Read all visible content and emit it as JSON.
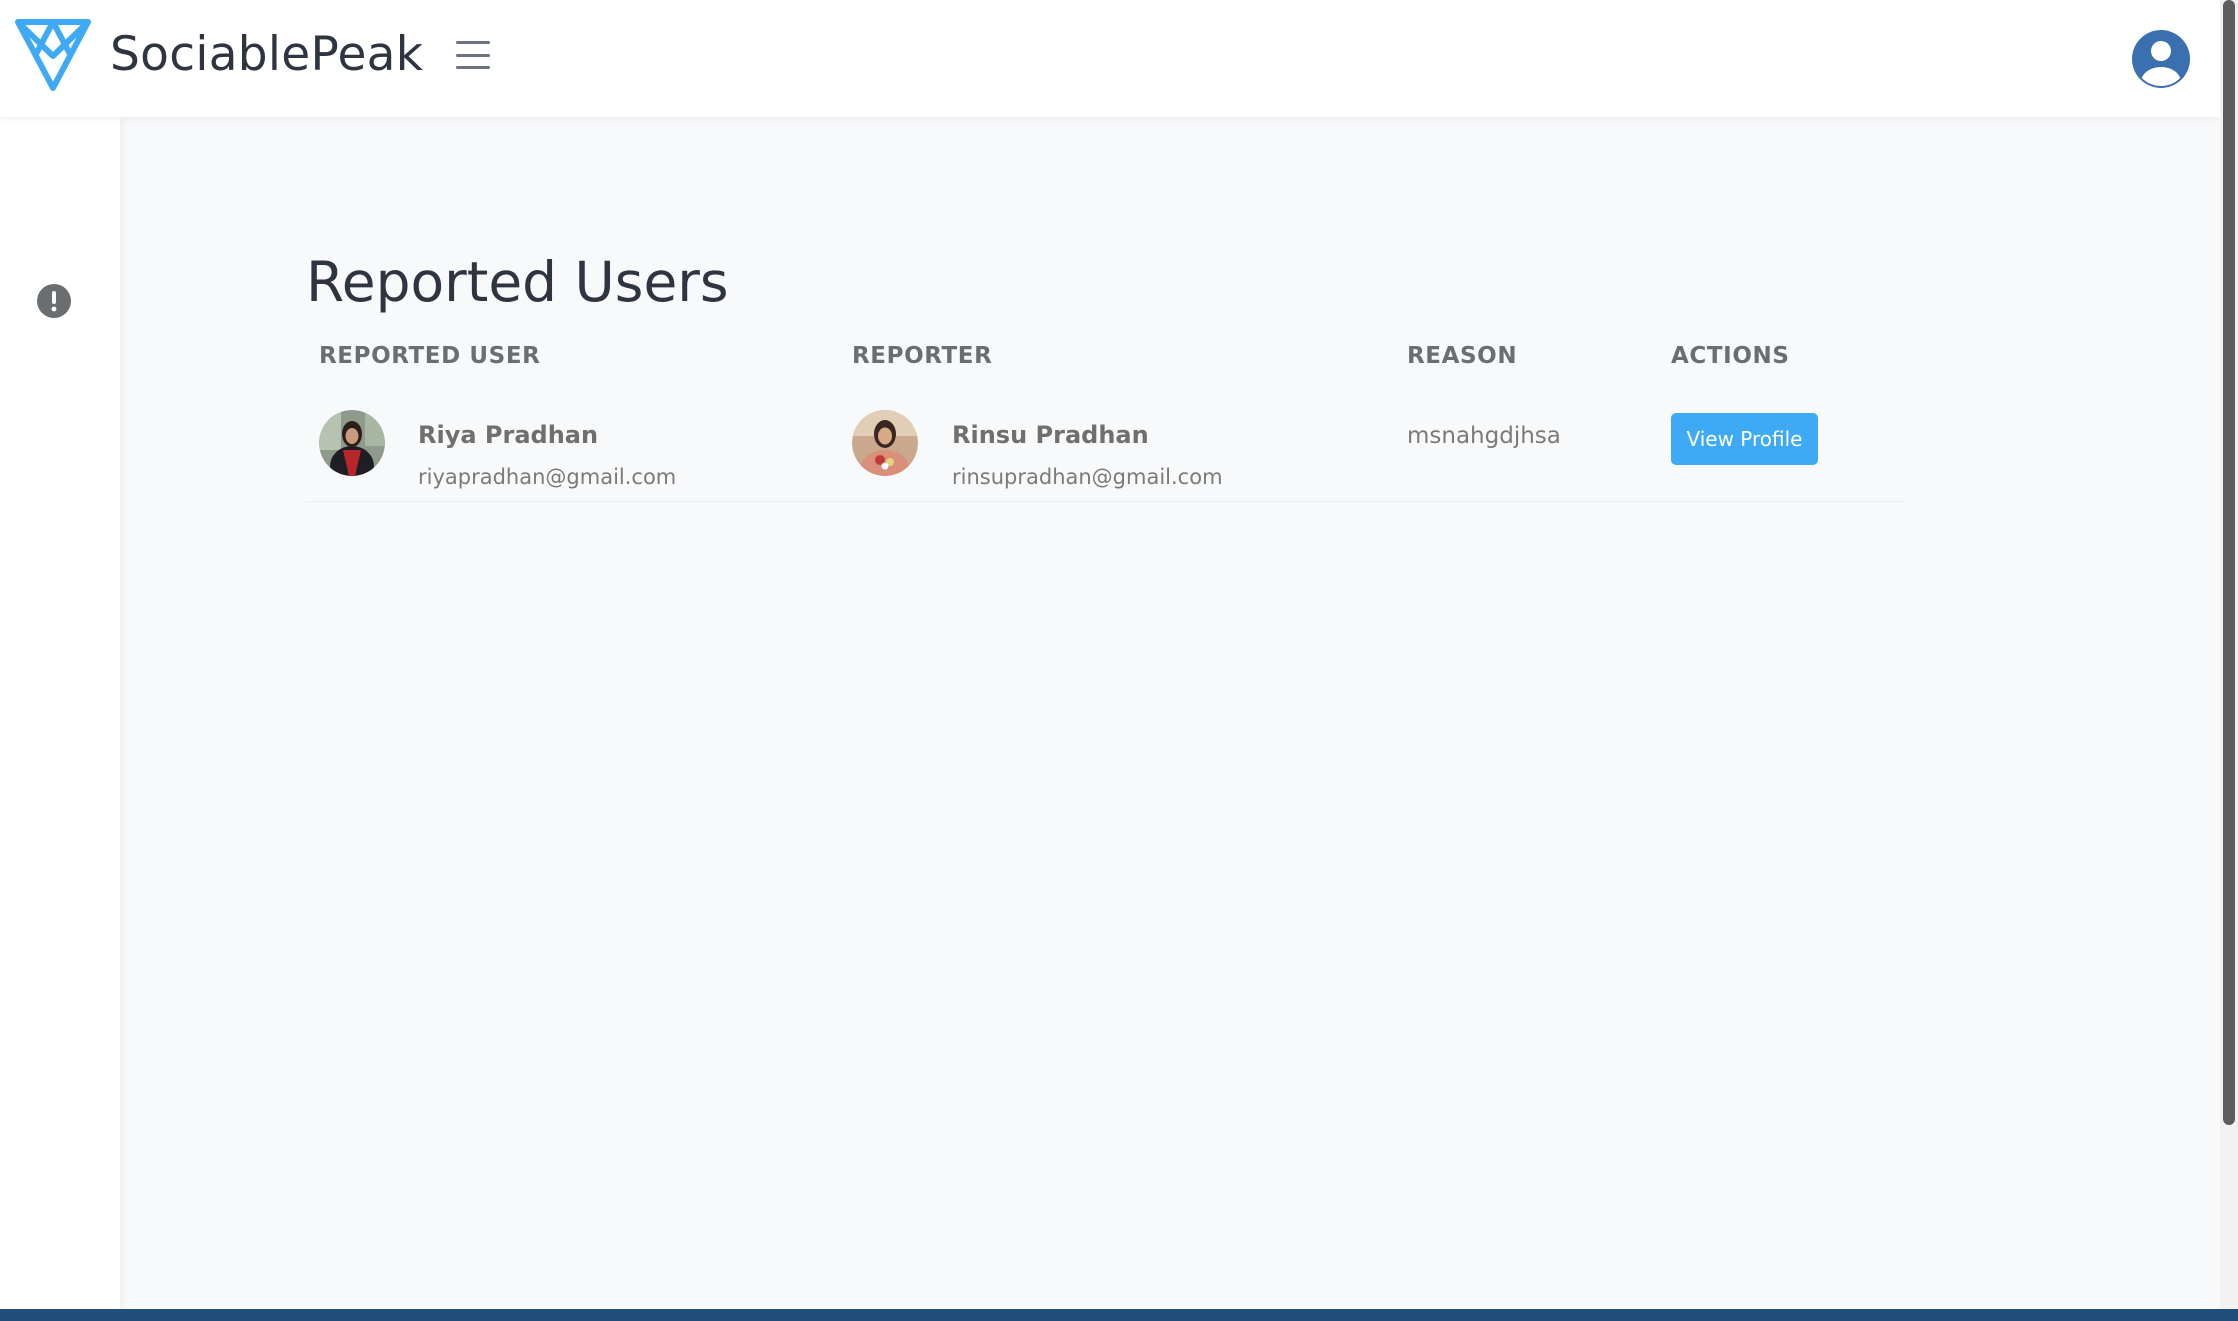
{
  "header": {
    "app_title": "SociablePeak",
    "brand_color": "#3eaaf5",
    "menu_icon": "hamburger-menu-icon",
    "user_icon": "user-circle-icon",
    "user_icon_color": "#3a6fb0"
  },
  "sidebar": {
    "items": [
      {
        "icon": "exclamation-circle-icon",
        "color": "#6b6e71"
      }
    ]
  },
  "main": {
    "title": "Reported Users",
    "columns": [
      "REPORTED USER",
      "REPORTER",
      "REASON",
      "ACTIONS"
    ],
    "rows": [
      {
        "reported_user": {
          "name": "Riya Pradhan",
          "email": "riyapradhan@gmail.com"
        },
        "reporter": {
          "name": "Rinsu Pradhan",
          "email": "rinsupradhan@gmail.com"
        },
        "reason": "msnahgdjhsa",
        "action_label": "View Profile"
      }
    ]
  }
}
